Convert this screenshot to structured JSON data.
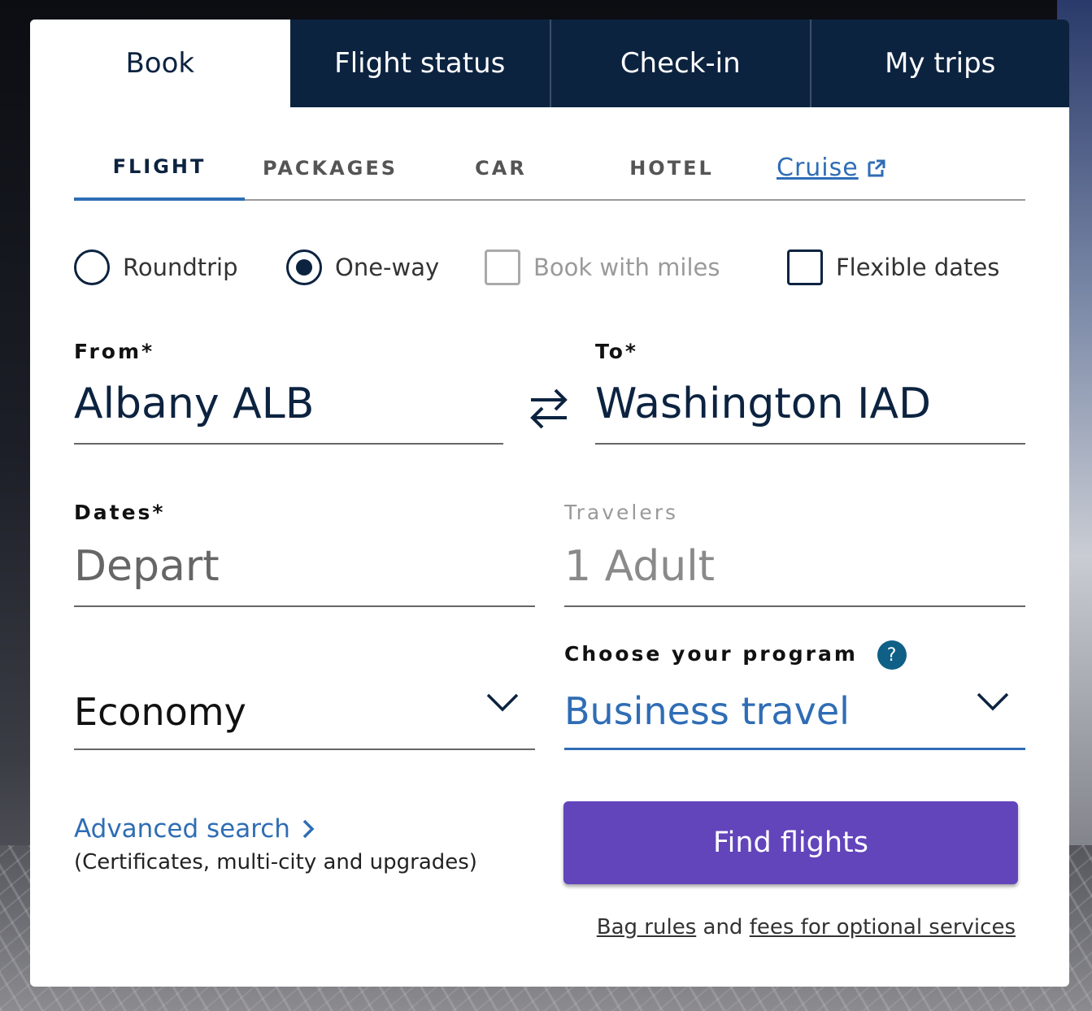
{
  "top_tabs": [
    "Book",
    "Flight status",
    "Check-in",
    "My trips"
  ],
  "sub_tabs": {
    "flight": "FLIGHT",
    "packages": "PACKAGES",
    "car": "CAR",
    "hotel": "HOTEL",
    "cruise": "Cruise"
  },
  "options": {
    "roundtrip": "Roundtrip",
    "oneway": "One-way",
    "book_with_miles": "Book with miles",
    "flexible_dates": "Flexible dates"
  },
  "from": {
    "label": "From*",
    "value": "Albany ALB"
  },
  "to": {
    "label": "To*",
    "value": "Washington IAD"
  },
  "dates": {
    "label": "Dates*",
    "placeholder": "Depart"
  },
  "travelers": {
    "label": "Travelers",
    "value": "1 Adult"
  },
  "cabin": {
    "value": "Economy"
  },
  "program": {
    "label": "Choose your program",
    "value": "Business travel",
    "help": "?"
  },
  "advanced": {
    "label": "Advanced search",
    "note": "(Certificates, multi-city and upgrades)"
  },
  "find_button": "Find flights",
  "fees": {
    "bag_rules": "Bag rules",
    "and": "and",
    "fees_link": "fees for optional services"
  },
  "colors": {
    "navy": "#0c2340",
    "link_blue": "#2f6db5",
    "button_purple": "#6244bb"
  }
}
